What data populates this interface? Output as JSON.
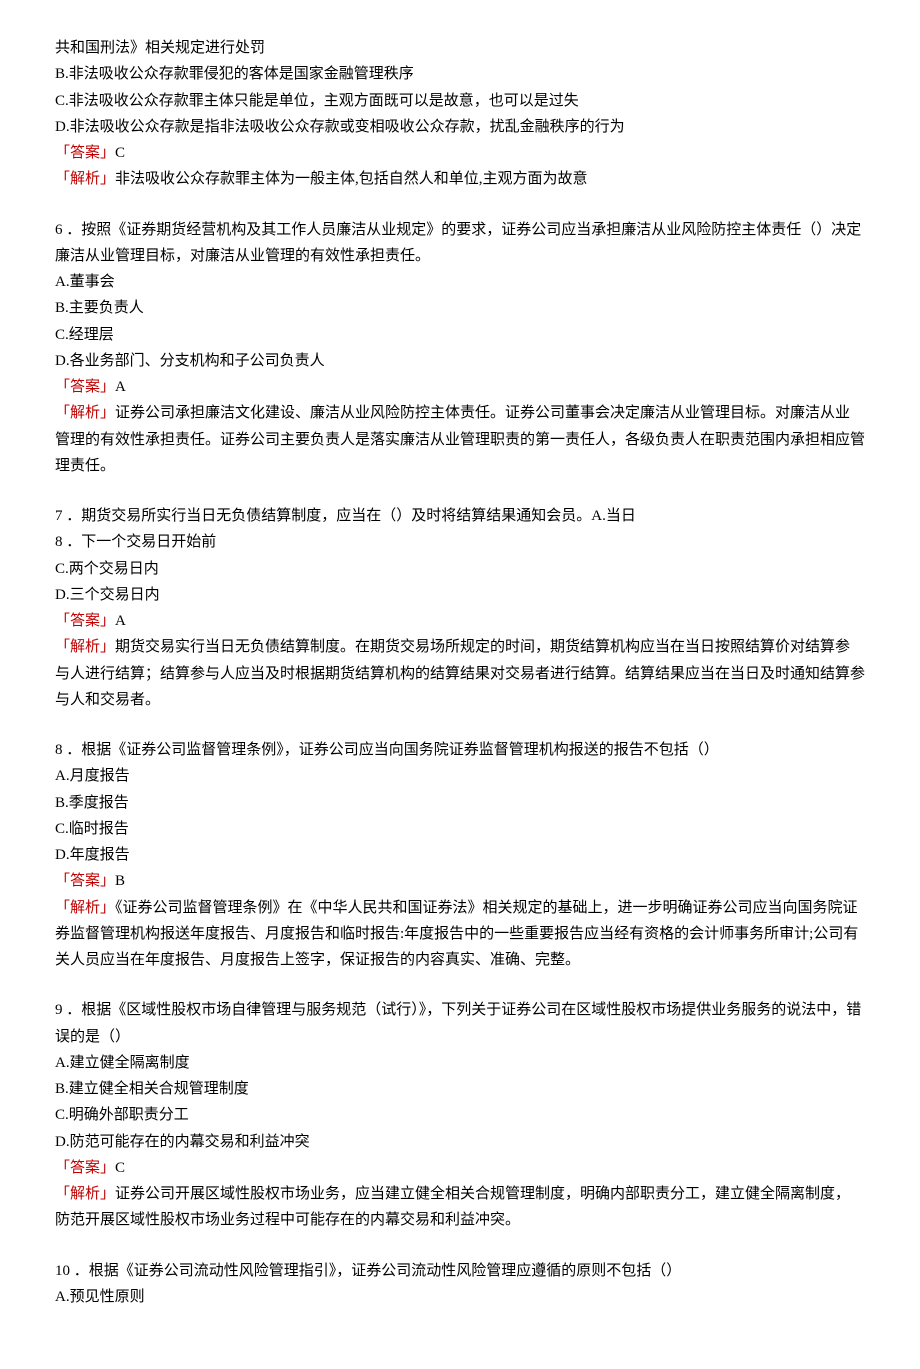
{
  "q5": {
    "cont": "共和国刑法》相关规定进行处罚",
    "B": "B.非法吸收公众存款罪侵犯的客体是国家金融管理秩序",
    "C": "C.非法吸收公众存款罪主体只能是单位，主观方面既可以是故意，也可以是过失",
    "D": "D.非法吸收公众存款是指非法吸收公众存款或变相吸收公众存款，扰乱金融秩序的行为",
    "ans_label": "「答案」",
    "ans": "C",
    "exp_label": "「解析」",
    "exp": "非法吸收公众存款罪主体为一般主体,包括自然人和单位,主观方面为故意"
  },
  "q6": {
    "stem": "6 ．按照《证券期货经营机构及其工作人员廉洁从业规定》的要求，证券公司应当承担廉洁从业风险防控主体责任（）决定廉洁从业管理目标，对廉洁从业管理的有效性承担责任。",
    "A": "A.董事会",
    "B": "B.主要负责人",
    "C": "C.经理层",
    "D": "D.各业务部门、分支机构和子公司负责人",
    "ans_label": "「答案」",
    "ans": "A",
    "exp_label": "「解析」",
    "exp": "证券公司承担廉洁文化建设、廉洁从业风险防控主体责任。证券公司董事会决定廉洁从业管理目标。对廉洁从业管理的有效性承担责任。证券公司主要负责人是落实廉洁从业管理职责的第一责任人，各级负责人在职责范围内承担相应管理责任。"
  },
  "q7": {
    "stem": "7 ．期货交易所实行当日无负债结算制度，应当在（）及时将结算结果通知会员。A.当日",
    "B": "8 ．下一个交易日开始前",
    "C": "C.两个交易日内",
    "D": "D.三个交易日内",
    "ans_label": "「答案」",
    "ans": "A",
    "exp_label": "「解析」",
    "exp": "期货交易实行当日无负债结算制度。在期货交易场所规定的时间，期货结算机构应当在当日按照结算价对结算参与人进行结算；结算参与人应当及时根据期货结算机构的结算结果对交易者进行结算。结算结果应当在当日及时通知结算参与人和交易者。"
  },
  "q8": {
    "stem": "8 ．根据《证券公司监督管理条例》，证券公司应当向国务院证券监督管理机构报送的报告不包括（）",
    "A": "A.月度报告",
    "B": "B.季度报告",
    "C": "C.临时报告",
    "D": "D.年度报告",
    "ans_label": "「答案」",
    "ans": "B",
    "exp_label": "「解析」",
    "exp": "《证券公司监督管理条例》在《中华人民共和国证券法》相关规定的基础上，进一步明确证券公司应当向国务院证券监督管理机构报送年度报告、月度报告和临时报告:年度报告中的一些重要报告应当经有资格的会计师事务所审计;公司有关人员应当在年度报告、月度报告上签字，保证报告的内容真实、准确、完整。"
  },
  "q9": {
    "stem": "9 ．根据《区域性股权市场自律管理与服务规范（试行）》，下列关于证券公司在区域性股权市场提供业务服务的说法中，错误的是（）",
    "A": "A.建立健全隔离制度",
    "B": "B.建立健全相关合规管理制度",
    "C": "C.明确外部职责分工",
    "D": "D.防范可能存在的内幕交易和利益冲突",
    "ans_label": "「答案」",
    "ans": "C",
    "exp_label": "「解析」",
    "exp": "证券公司开展区域性股权市场业务，应当建立健全相关合规管理制度，明确内部职责分工，建立健全隔离制度，防范开展区域性股权市场业务过程中可能存在的内幕交易和利益冲突。"
  },
  "q10": {
    "stem": "10 ．根据《证券公司流动性风险管理指引》，证券公司流动性风险管理应遵循的原则不包括（）",
    "A": "A.预见性原则"
  }
}
